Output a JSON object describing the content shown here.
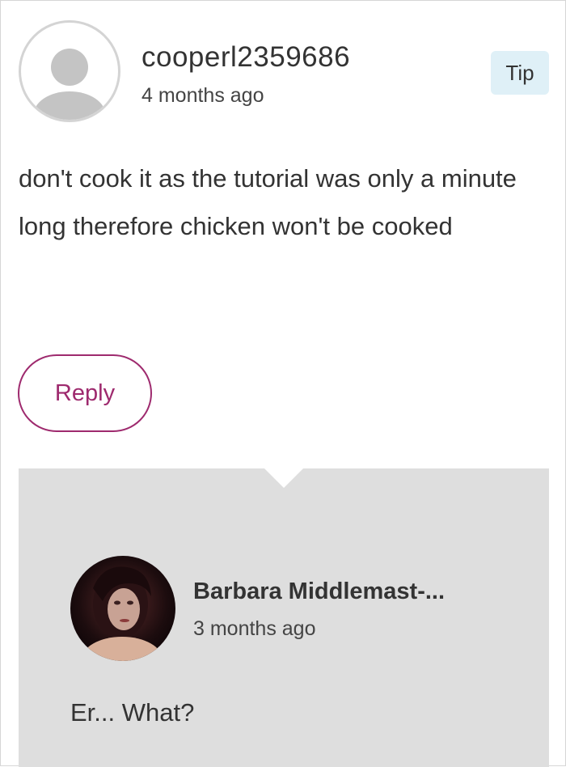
{
  "comment": {
    "username": "cooperl2359686",
    "timestamp": "4 months ago",
    "badge_label": "Tip",
    "body": "don't cook it as the tutorial was only a minute long therefore chicken won't be cooked",
    "reply_label": "Reply",
    "avatar_icon": "default-user-avatar-icon"
  },
  "reply": {
    "author": "Barbara Middlemast-...",
    "timestamp": "3 months ago",
    "body": "Er... What?",
    "avatar_icon": "user-photo-avatar"
  },
  "colors": {
    "accent": "#9e2a6e",
    "tip_background": "#dff0f7",
    "reply_panel": "#dedede",
    "text": "#333333"
  }
}
